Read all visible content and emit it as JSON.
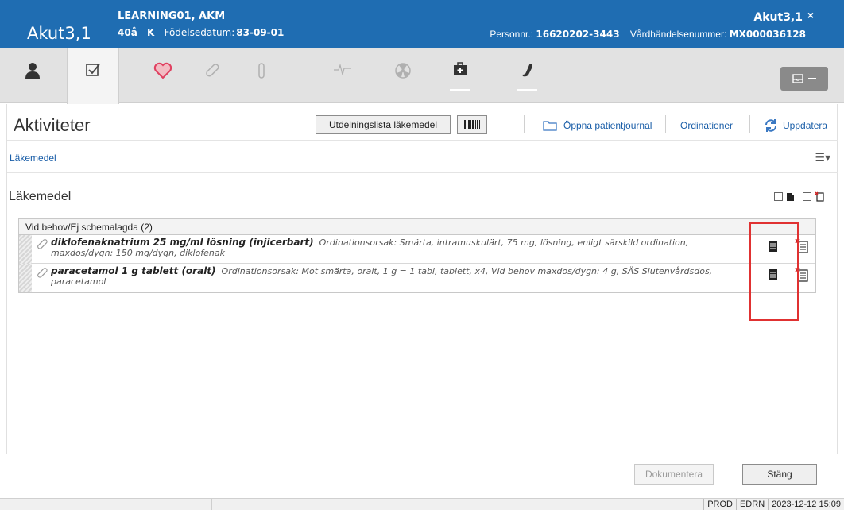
{
  "header": {
    "unit": "Akut3,1",
    "patient_name": "LEARNING01, AKM",
    "age": "40å",
    "sex": "K",
    "dob_label": "Födelsedatum:",
    "dob": "83-09-01",
    "unit_right": "Akut3,1",
    "close": "×",
    "personnr_label": "Personnr.:",
    "personnr": "16620202-3443",
    "vardhandelse_label": "Vårdhändelsenummer:",
    "vardhandelse": "MX000036128"
  },
  "page": {
    "title": "Aktiviteter",
    "utdelning_button": "Utdelningslista läkemedel",
    "open_journal": "Öppna patientjournal",
    "ordinationer": "Ordinationer",
    "uppdatera": "Uppdatera",
    "sub_link": "Läkemedel",
    "menu_icon": "☰▾",
    "section_title": "Läkemedel"
  },
  "list": {
    "group_header": "Vid behov/Ej schemalagda (2)",
    "rows": [
      {
        "name": "diklofenaknatrium 25 mg/ml lösning (injicerbart)",
        "detail": "Ordinationsorsak: Smärta, intramuskulärt, 75 mg, lösning, enligt särskild ordination, maxdos/dygn: 150 mg/dygn, diklofenak"
      },
      {
        "name": "paracetamol 1 g tablett (oralt)",
        "detail": "Ordinationsorsak: Mot smärta, oralt, 1 g = 1 tabl, tablett, x4, Vid behov maxdos/dygn: 4 g, SÄS Slutenvårdsdos, paracetamol"
      }
    ]
  },
  "footer": {
    "dokumentera": "Dokumentera",
    "stang": "Stäng"
  },
  "status": {
    "env": "PROD",
    "code": "EDRN",
    "datetime": "2023-12-12  15:09"
  },
  "colors": {
    "header_bg": "#1f6db2",
    "link": "#1a5ea8",
    "highlight": "#e03131"
  }
}
